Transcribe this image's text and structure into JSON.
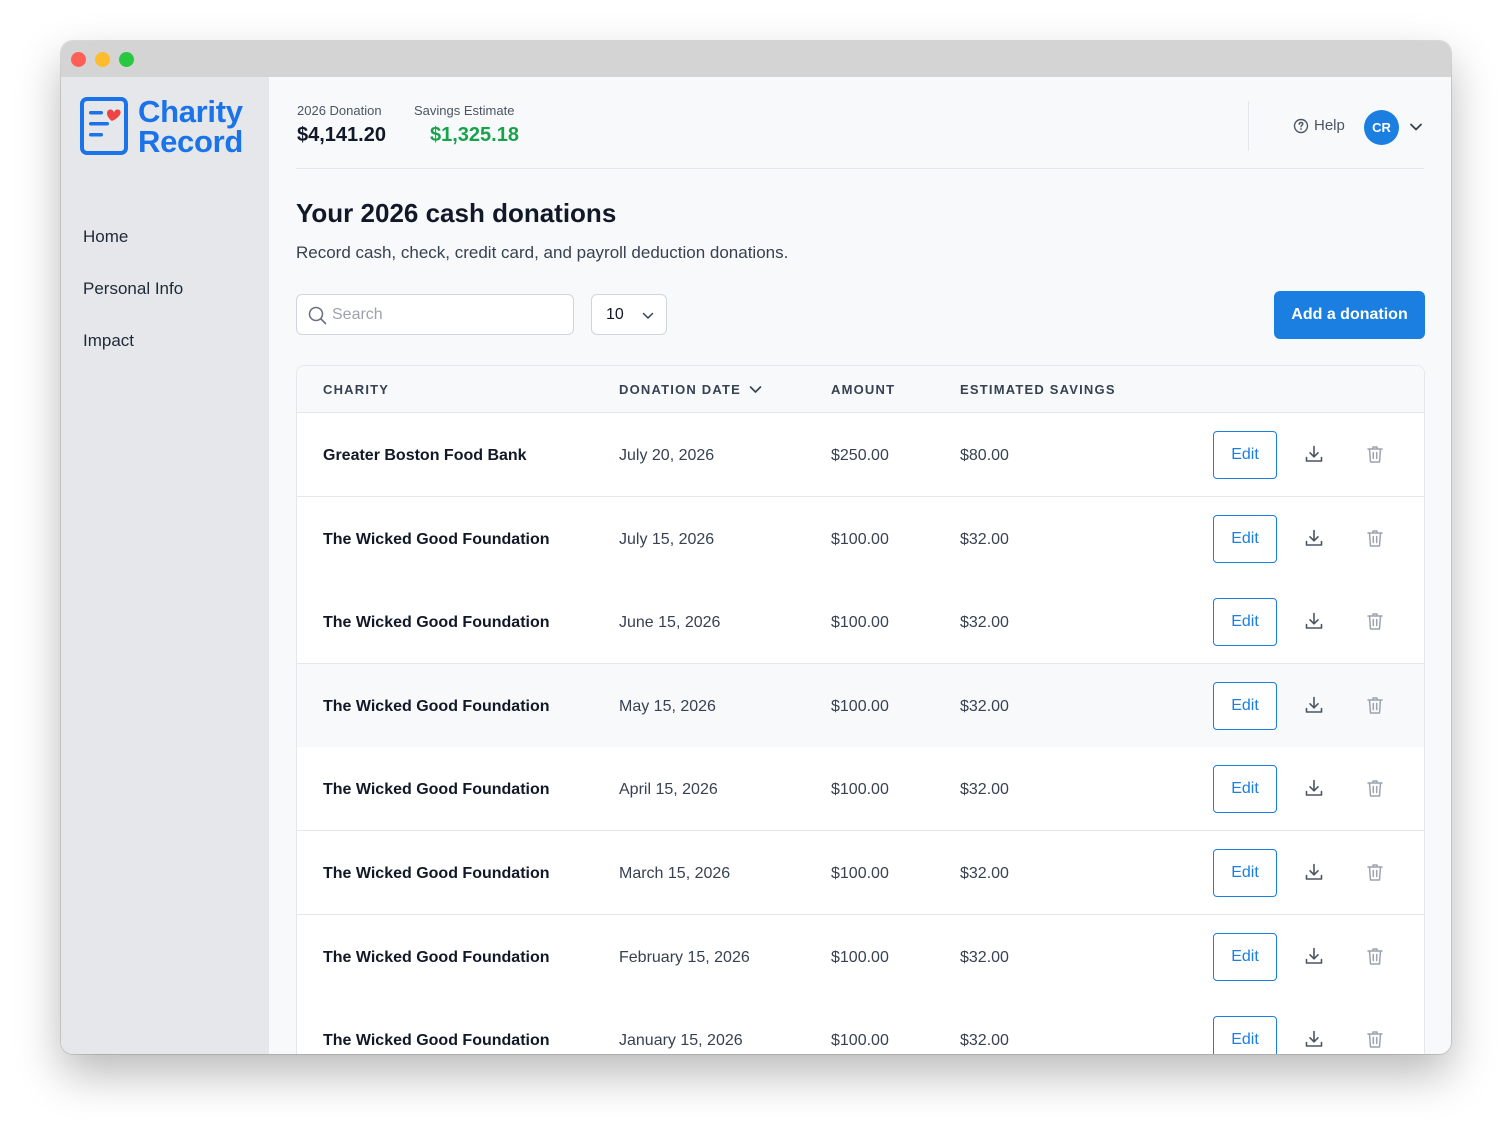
{
  "app": {
    "logo_line1": "Charity",
    "logo_line2": "Record",
    "brand_color": "#1a73e8",
    "accent_color": "#1a7fe0",
    "positive_color": "#16a34a"
  },
  "sidebar": {
    "items": [
      {
        "label": "Home"
      },
      {
        "label": "Personal Info"
      },
      {
        "label": "Impact"
      }
    ]
  },
  "header": {
    "donation_label": "2026 Donation",
    "donation_value": "$4,141.20",
    "savings_label": "Savings Estimate",
    "savings_value": "$1,325.18",
    "help_label": "Help",
    "avatar_initials": "CR"
  },
  "page": {
    "title": "Your 2026 cash donations",
    "subtitle": "Record cash, check, credit card, and payroll deduction donations."
  },
  "controls": {
    "search_placeholder": "Search",
    "search_value": "",
    "page_size": "10",
    "add_button": "Add a donation"
  },
  "table": {
    "columns": [
      "CHARITY",
      "DONATION DATE",
      "AMOUNT",
      "ESTIMATED SAVINGS"
    ],
    "sort_column": "DONATION DATE",
    "sort_direction": "descending",
    "edit_label": "Edit",
    "rows": [
      {
        "charity": "Greater Boston Food Bank",
        "date": "July 20, 2026",
        "amount": "$250.00",
        "savings": "$80.00"
      },
      {
        "charity": "The Wicked Good Foundation",
        "date": "July 15, 2026",
        "amount": "$100.00",
        "savings": "$32.00"
      },
      {
        "charity": "The Wicked Good Foundation",
        "date": "June 15, 2026",
        "amount": "$100.00",
        "savings": "$32.00"
      },
      {
        "charity": "The Wicked Good Foundation",
        "date": "May 15, 2026",
        "amount": "$100.00",
        "savings": "$32.00"
      },
      {
        "charity": "The Wicked Good Foundation",
        "date": "April 15, 2026",
        "amount": "$100.00",
        "savings": "$32.00"
      },
      {
        "charity": "The Wicked Good Foundation",
        "date": "March 15, 2026",
        "amount": "$100.00",
        "savings": "$32.00"
      },
      {
        "charity": "The Wicked Good Foundation",
        "date": "February 15, 2026",
        "amount": "$100.00",
        "savings": "$32.00"
      },
      {
        "charity": "The Wicked Good Foundation",
        "date": "January 15, 2026",
        "amount": "$100.00",
        "savings": "$32.00"
      }
    ]
  }
}
